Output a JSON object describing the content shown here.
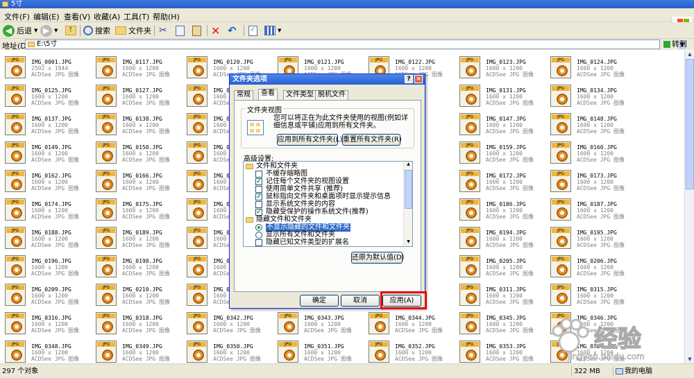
{
  "window": {
    "title": "5寸"
  },
  "menu": [
    "文件(F)",
    "编辑(E)",
    "查看(V)",
    "收藏(A)",
    "工具(T)",
    "帮助(H)"
  ],
  "toolbar": {
    "back": "后退",
    "search": "搜索",
    "folders": "文件夹"
  },
  "address": {
    "label": "地址(D)",
    "value": "E:\\5寸",
    "go": "转到"
  },
  "files": [
    {
      "name": "IMG_0001.JPG",
      "dim": "2592 x 1944",
      "type": "ACDSee JPG 图像"
    },
    {
      "name": "IMG_0117.JPG",
      "dim": "1600 x 1200",
      "type": "ACDSee JPG 图像"
    },
    {
      "name": "IMG_0120.JPG",
      "dim": "1600 x 1200",
      "type": "ACDSee JPG 图像"
    },
    {
      "name": "IMG_0121.JPG",
      "dim": "1600 x 1200",
      "type": "ACDSee JPG 图像"
    },
    {
      "name": "IMG_0122.JPG",
      "dim": "1600 x 1200",
      "type": "ACDSee JPG 图像"
    },
    {
      "name": "IMG_0123.JPG",
      "dim": "1600 x 1200",
      "type": "ACDSee JPG 图像"
    },
    {
      "name": "IMG_0124.JPG",
      "dim": "1600 x 1200",
      "type": "ACDSee JPG 图像"
    },
    {
      "name": "IMG_0125.JPG",
      "dim": "1600 x 1200",
      "type": "ACDSee JPG 图像"
    },
    {
      "name": "IMG_0127.JPG",
      "dim": "1600 x 1200",
      "type": "ACDSee JPG 图像"
    },
    {
      "name": "IMG_0.",
      "dim": "1600 x 1200",
      "type": "ACDSee JPG 图像"
    },
    {
      "name": "",
      "dim": "",
      "type": ""
    },
    {
      "name": "",
      "dim": "",
      "type": ""
    },
    {
      "name": "IMG_0131.JPG",
      "dim": "1600 x 1200",
      "type": "ACDSee JPG 图像"
    },
    {
      "name": "IMG_0134.JPG",
      "dim": "1600 x 1200",
      "type": "ACDSee JPG 图像"
    },
    {
      "name": "IMG_0137.JPG",
      "dim": "1600 x 1200",
      "type": "ACDSee JPG 图像"
    },
    {
      "name": "IMG_0138.JPG",
      "dim": "1600 x 1200",
      "type": "ACDSee JPG 图像"
    },
    {
      "name": "IMG_01",
      "dim": "1600 x 1200",
      "type": "ACDSee JPG 图像"
    },
    {
      "name": "",
      "dim": "",
      "type": ""
    },
    {
      "name": "",
      "dim": "",
      "type": ""
    },
    {
      "name": "IMG_0147.JPG",
      "dim": "1600 x 1200",
      "type": "ACDSee JPG 图像"
    },
    {
      "name": "IMG_0148.JPG",
      "dim": "1600 x 1200",
      "type": "ACDSee JPG 图像"
    },
    {
      "name": "IMG_0149.JPG",
      "dim": "1600 x 1200",
      "type": "ACDSee JPG 图像"
    },
    {
      "name": "IMG_0150.JPG",
      "dim": "1600 x 1200",
      "type": "ACDSee JPG 图像"
    },
    {
      "name": "IMG_01",
      "dim": "1600 x 1200",
      "type": "ACDSee JPG 图像"
    },
    {
      "name": "",
      "dim": "",
      "type": ""
    },
    {
      "name": "",
      "dim": "",
      "type": ""
    },
    {
      "name": "IMG_0159.JPG",
      "dim": "1600 x 1200",
      "type": "ACDSee JPG 图像"
    },
    {
      "name": "IMG_0160.JPG",
      "dim": "1600 x 1200",
      "type": "ACDSee JPG 图像"
    },
    {
      "name": "IMG_0162.JPG",
      "dim": "1600 x 1200",
      "type": "ACDSee JPG 图像"
    },
    {
      "name": "IMG_0166.JPG",
      "dim": "1600 x 1200",
      "type": "ACDSee JPG 图像"
    },
    {
      "name": "IMG_01",
      "dim": "1600 x 1200",
      "type": "ACDSee JPG 图像"
    },
    {
      "name": "",
      "dim": "",
      "type": ""
    },
    {
      "name": "",
      "dim": "",
      "type": ""
    },
    {
      "name": "IMG_0172.JPG",
      "dim": "1600 x 1200",
      "type": "ACDSee JPG 图像"
    },
    {
      "name": "IMG_0173.JPG",
      "dim": "1600 x 1200",
      "type": "ACDSee JPG 图像"
    },
    {
      "name": "IMG_0174.JPG",
      "dim": "1600 x 1200",
      "type": "ACDSee JPG 图像"
    },
    {
      "name": "IMG_0175.JPG",
      "dim": "1600 x 1200",
      "type": "ACDSee JPG 图像"
    },
    {
      "name": "IMG_01",
      "dim": "1600 x 1200",
      "type": "ACDSee JPG 图像"
    },
    {
      "name": "",
      "dim": "",
      "type": ""
    },
    {
      "name": "",
      "dim": "",
      "type": ""
    },
    {
      "name": "IMG_0186.JPG",
      "dim": "1600 x 1200",
      "type": "ACDSee JPG 图像"
    },
    {
      "name": "IMG_0187.JPG",
      "dim": "1600 x 1200",
      "type": "ACDSee JPG 图像"
    },
    {
      "name": "IMG_0188.JPG",
      "dim": "1600 x 1200",
      "type": "ACDSee JPG 图像"
    },
    {
      "name": "IMG_0189.JPG",
      "dim": "1600 x 1200",
      "type": "ACDSee JPG 图像"
    },
    {
      "name": "IMG_01",
      "dim": "1600 x 1200",
      "type": "ACDSee JPG 图像"
    },
    {
      "name": "",
      "dim": "",
      "type": ""
    },
    {
      "name": "",
      "dim": "",
      "type": ""
    },
    {
      "name": "IMG_0194.JPG",
      "dim": "1600 x 1200",
      "type": "ACDSee JPG 图像"
    },
    {
      "name": "IMG_0195.JPG",
      "dim": "1600 x 1200",
      "type": "ACDSee JPG 图像"
    },
    {
      "name": "IMG_0196.JPG",
      "dim": "1600 x 1200",
      "type": "ACDSee JPG 图像"
    },
    {
      "name": "IMG_0198.JPG",
      "dim": "1600 x 1200",
      "type": "ACDSee JPG 图像"
    },
    {
      "name": "IMG_01",
      "dim": "1600 x 1200",
      "type": "ACDSee JPG 图像"
    },
    {
      "name": "",
      "dim": "",
      "type": ""
    },
    {
      "name": "",
      "dim": "",
      "type": ""
    },
    {
      "name": "IMG_0205.JPG",
      "dim": "1600 x 1200",
      "type": "ACDSee JPG 图像"
    },
    {
      "name": "IMG_0206.JPG",
      "dim": "1600 x 1200",
      "type": "ACDSee JPG 图像"
    },
    {
      "name": "IMG_0209.JPG",
      "dim": "1600 x 1200",
      "type": "ACDSee JPG 图像"
    },
    {
      "name": "IMG_0210.JPG",
      "dim": "1600 x 1200",
      "type": "ACDSee JPG 图像"
    },
    {
      "name": "IMG_02",
      "dim": "1600 x 1200",
      "type": "ACDSee JPG 图像"
    },
    {
      "name": "",
      "dim": "",
      "type": ""
    },
    {
      "name": "",
      "dim": "",
      "type": ""
    },
    {
      "name": "IMG_0311.JPG",
      "dim": "1600 x 1200",
      "type": "ACDSee JPG 图像"
    },
    {
      "name": "IMG_0315.JPG",
      "dim": "1600 x 1200",
      "type": "ACDSee JPG 图像"
    },
    {
      "name": "IMG_0316.JPG",
      "dim": "1600 x 1200",
      "type": "ACDSee JPG 图像"
    },
    {
      "name": "IMG_0318.JPG",
      "dim": "1600 x 1200",
      "type": "ACDSee JPG 图像"
    },
    {
      "name": "IMG_0342.JPG",
      "dim": "1600 x 1200",
      "type": "ACDSee JPG 图像"
    },
    {
      "name": "IMG_0343.JPG",
      "dim": "1600 x 1200",
      "type": "ACDSee JPG 图像"
    },
    {
      "name": "IMG_0344.JPG",
      "dim": "1600 x 1200",
      "type": "ACDSee JPG 图像"
    },
    {
      "name": "IMG_0345.JPG",
      "dim": "1600 x 1200",
      "type": "ACDSee JPG 图像"
    },
    {
      "name": "IMG_0346.JPG",
      "dim": "1600 x 1200",
      "type": "ACDSee JPG 图像"
    },
    {
      "name": "IMG_0348.JPG",
      "dim": "1600 x 1200",
      "type": "ACDSee JPG 图像"
    },
    {
      "name": "IMG_0349.JPG",
      "dim": "1600 x 1200",
      "type": "ACDSee JPG 图像"
    },
    {
      "name": "IMG_0350.JPG",
      "dim": "1600 x 1200",
      "type": "ACDSee JPG 图像"
    },
    {
      "name": "IMG_0351.JPG",
      "dim": "1600 x 1200",
      "type": "ACDSee JPG 图像"
    },
    {
      "name": "IMG_0352.JPG",
      "dim": "1600 x 1200",
      "type": "ACDSee JPG 图像"
    },
    {
      "name": "IMG_0353.JPG",
      "dim": "1600 x 1200",
      "type": "ACDSee JPG 图像"
    },
    {
      "name": "IMG_0354.JPG",
      "dim": "1600 x 1200",
      "type": "ACDSee JPG 图像"
    }
  ],
  "status": {
    "count": "297 个对象",
    "size": "322 MB",
    "location": "我的电脑"
  },
  "dialog": {
    "title": "文件夹选项",
    "help": "?",
    "close": "×",
    "tabs": [
      "常规",
      "查看",
      "文件类型",
      "脱机文件"
    ],
    "group_title": "文件夹视图",
    "group_desc": "您可以将正在为此文件夹使用的视图(例如详细信息或平铺)应用到所有文件夹。",
    "apply_all": "应用到所有文件夹(L)",
    "reset_all": "重置所有文件夹(R)",
    "advanced_label": "高级设置:",
    "tree": [
      {
        "kind": "folder",
        "label": "文件和文件夹"
      },
      {
        "kind": "checkbox",
        "checked": false,
        "label": "不缓存缩略图"
      },
      {
        "kind": "checkbox",
        "checked": true,
        "label": "记住每个文件夹的视图设置"
      },
      {
        "kind": "checkbox",
        "checked": false,
        "label": "使用简单文件共享 (推荐)"
      },
      {
        "kind": "checkbox",
        "checked": true,
        "label": "鼠标指向文件夹和桌面项时显示提示信息"
      },
      {
        "kind": "checkbox",
        "checked": false,
        "label": "显示系统文件夹的内容"
      },
      {
        "kind": "checkbox",
        "checked": true,
        "label": "隐藏受保护的操作系统文件(推荐)"
      },
      {
        "kind": "folder",
        "label": "隐藏文件和文件夹"
      },
      {
        "kind": "radio",
        "checked": true,
        "selected": true,
        "label": "不显示隐藏的文件和文件夹"
      },
      {
        "kind": "radio",
        "checked": false,
        "label": "显示所有文件和文件夹"
      },
      {
        "kind": "checkbox",
        "checked": false,
        "label": "隐藏已知文件类型的扩展名"
      }
    ],
    "restore": "还原为默认值(D)",
    "ok": "确定",
    "cancel": "取消",
    "apply": "应用(A)"
  },
  "watermark": {
    "brand": "经验",
    "url": "jingyan.baidu.com"
  }
}
